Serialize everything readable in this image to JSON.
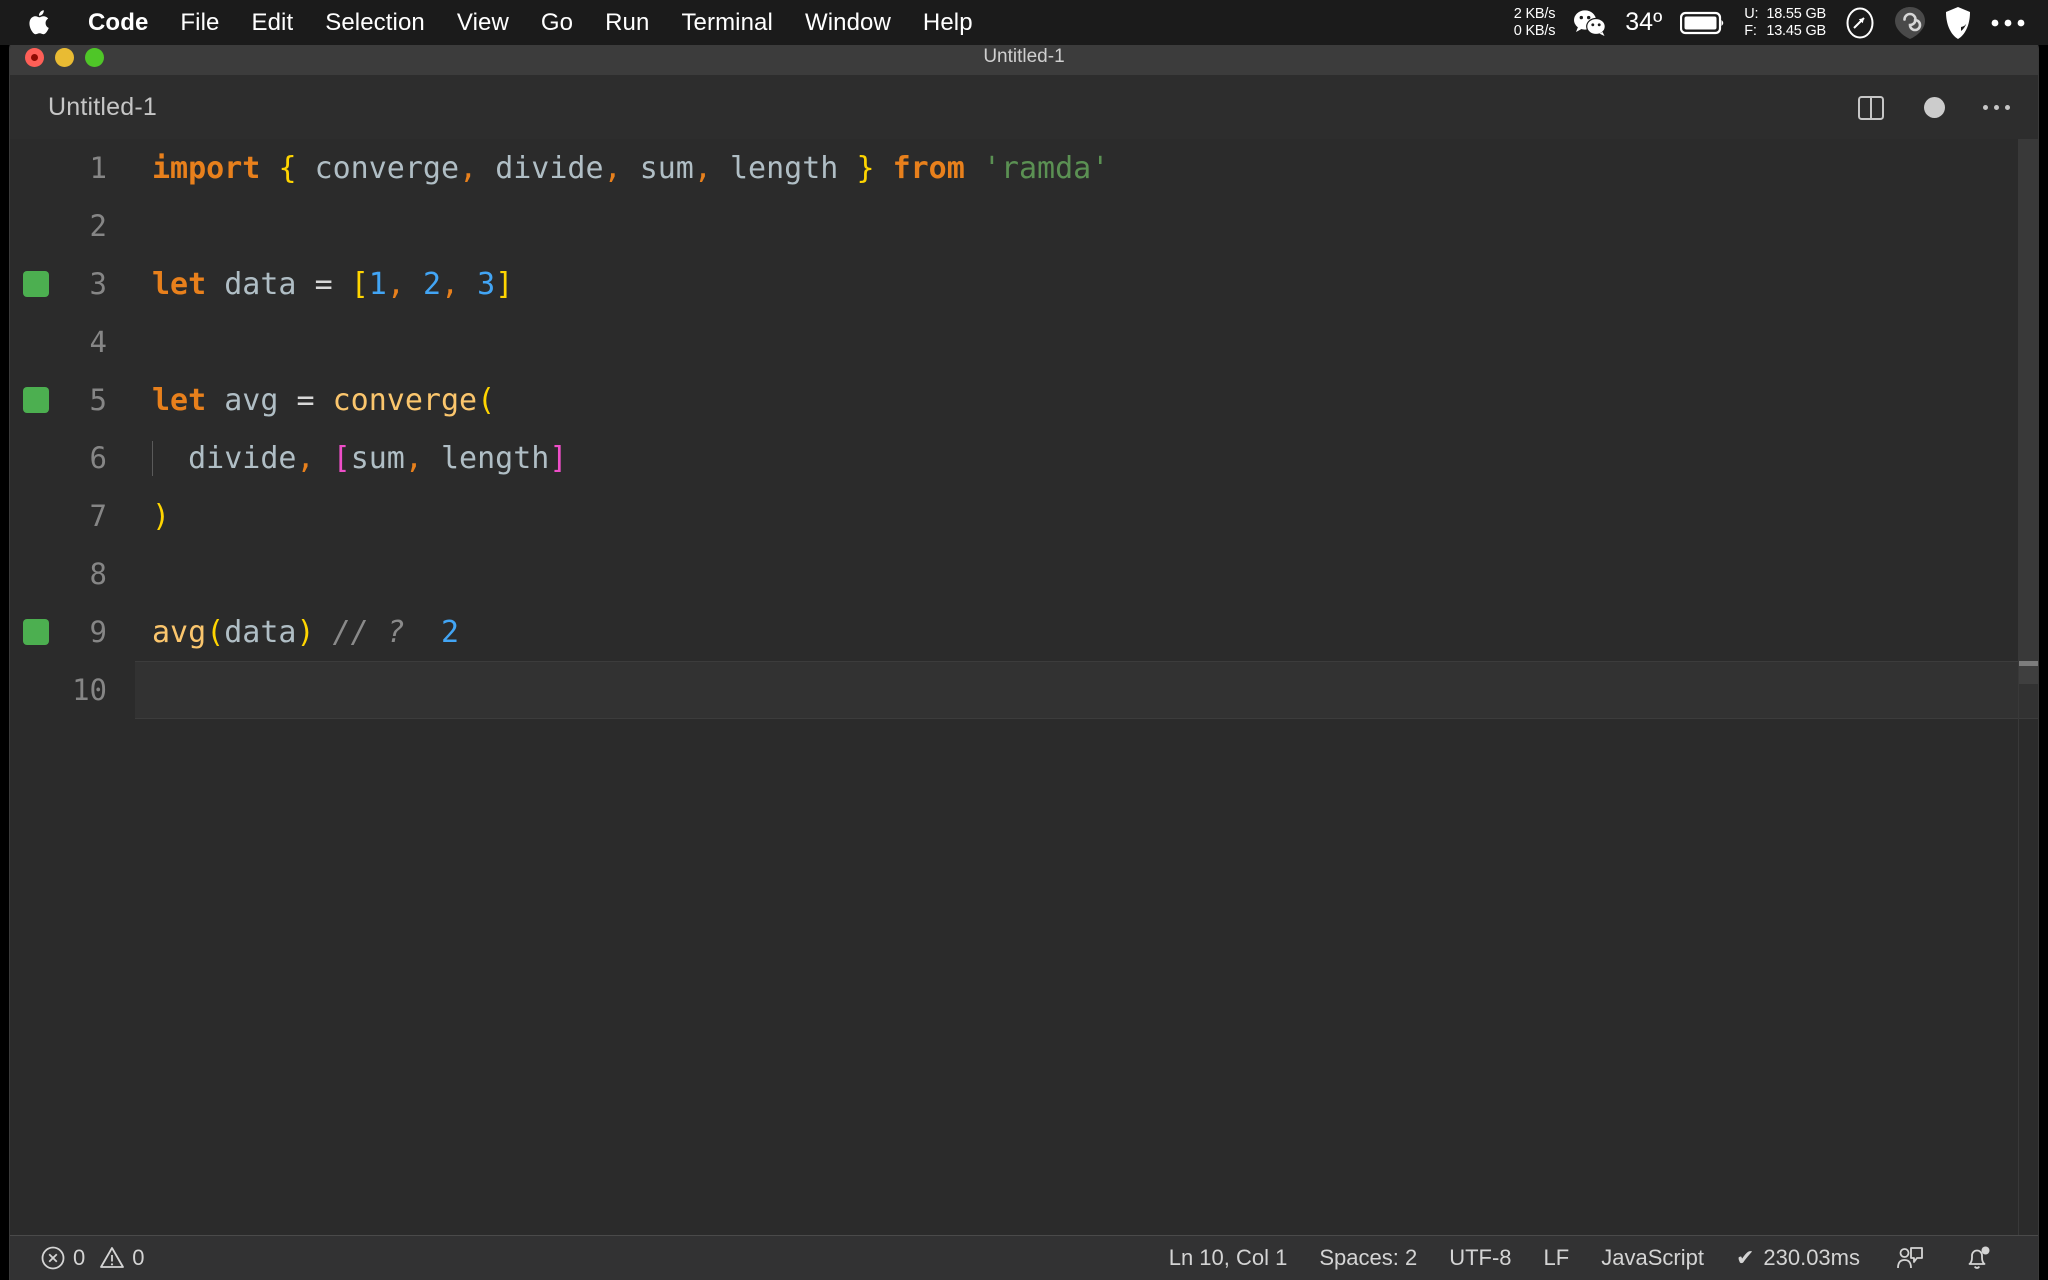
{
  "menubar": {
    "apple_icon": "apple-logo-icon",
    "items": [
      {
        "label": "Code",
        "bold": true
      },
      {
        "label": "File",
        "bold": false
      },
      {
        "label": "Edit",
        "bold": false
      },
      {
        "label": "Selection",
        "bold": false
      },
      {
        "label": "View",
        "bold": false
      },
      {
        "label": "Go",
        "bold": false
      },
      {
        "label": "Run",
        "bold": false
      },
      {
        "label": "Terminal",
        "bold": false
      },
      {
        "label": "Window",
        "bold": false
      },
      {
        "label": "Help",
        "bold": false
      }
    ],
    "status": {
      "net_up": "2 KB/s",
      "net_down": "0 KB/s",
      "wechat_icon": "wechat-icon",
      "temperature": "34º",
      "battery_icon": "battery-icon",
      "mem_used_label": "U:",
      "mem_used_value": "18.55 GB",
      "mem_free_label": "F:",
      "mem_free_value": "13.45 GB",
      "compass_icon": "compass-icon",
      "cloud_icon": "cloud-sync-icon",
      "shield_icon": "shield-icon",
      "more_icon": "control-center-more-icon"
    }
  },
  "window": {
    "title": "Untitled-1",
    "traffic": {
      "close": "close-window-button",
      "minimize": "minimize-window-button",
      "maximize": "maximize-window-button"
    }
  },
  "editor": {
    "tab_label": "Untitled-1",
    "split_icon": "split-editor-icon",
    "dirty_icon": "unsaved-changes-dot",
    "more_icon": "more-actions-icon",
    "lines": [
      {
        "num": "1",
        "marked": false,
        "indent_guide": false,
        "current": false,
        "tokens": [
          {
            "text": "import",
            "cls": "t-kw"
          },
          {
            "text": " ",
            "cls": "t-op"
          },
          {
            "text": "{",
            "cls": "t-br1"
          },
          {
            "text": " ",
            "cls": "t-op"
          },
          {
            "text": "converge",
            "cls": "t-ident"
          },
          {
            "text": ",",
            "cls": "t-punct"
          },
          {
            "text": " ",
            "cls": "t-op"
          },
          {
            "text": "divide",
            "cls": "t-ident"
          },
          {
            "text": ",",
            "cls": "t-punct"
          },
          {
            "text": " ",
            "cls": "t-op"
          },
          {
            "text": "sum",
            "cls": "t-ident"
          },
          {
            "text": ",",
            "cls": "t-punct"
          },
          {
            "text": " ",
            "cls": "t-op"
          },
          {
            "text": "length",
            "cls": "t-ident"
          },
          {
            "text": " ",
            "cls": "t-op"
          },
          {
            "text": "}",
            "cls": "t-br1"
          },
          {
            "text": " ",
            "cls": "t-op"
          },
          {
            "text": "from",
            "cls": "t-kw"
          },
          {
            "text": " ",
            "cls": "t-op"
          },
          {
            "text": "'ramda'",
            "cls": "t-str"
          }
        ]
      },
      {
        "num": "2",
        "marked": false,
        "indent_guide": false,
        "current": false,
        "tokens": []
      },
      {
        "num": "3",
        "marked": true,
        "indent_guide": false,
        "current": false,
        "tokens": [
          {
            "text": "let",
            "cls": "t-kw"
          },
          {
            "text": " ",
            "cls": "t-op"
          },
          {
            "text": "data",
            "cls": "t-ident"
          },
          {
            "text": " ",
            "cls": "t-op"
          },
          {
            "text": "=",
            "cls": "t-op"
          },
          {
            "text": " ",
            "cls": "t-op"
          },
          {
            "text": "[",
            "cls": "t-br1"
          },
          {
            "text": "1",
            "cls": "t-num"
          },
          {
            "text": ",",
            "cls": "t-punct"
          },
          {
            "text": " ",
            "cls": "t-op"
          },
          {
            "text": "2",
            "cls": "t-num"
          },
          {
            "text": ",",
            "cls": "t-punct"
          },
          {
            "text": " ",
            "cls": "t-op"
          },
          {
            "text": "3",
            "cls": "t-num"
          },
          {
            "text": "]",
            "cls": "t-br1"
          }
        ]
      },
      {
        "num": "4",
        "marked": false,
        "indent_guide": false,
        "current": false,
        "tokens": []
      },
      {
        "num": "5",
        "marked": true,
        "indent_guide": false,
        "current": false,
        "tokens": [
          {
            "text": "let",
            "cls": "t-kw"
          },
          {
            "text": " ",
            "cls": "t-op"
          },
          {
            "text": "avg",
            "cls": "t-ident"
          },
          {
            "text": " ",
            "cls": "t-op"
          },
          {
            "text": "=",
            "cls": "t-op"
          },
          {
            "text": " ",
            "cls": "t-op"
          },
          {
            "text": "converge",
            "cls": "t-func"
          },
          {
            "text": "(",
            "cls": "t-br1"
          }
        ]
      },
      {
        "num": "6",
        "marked": false,
        "indent_guide": true,
        "current": false,
        "tokens": [
          {
            "text": "  ",
            "cls": "t-op"
          },
          {
            "text": "divide",
            "cls": "t-ident"
          },
          {
            "text": ",",
            "cls": "t-punct"
          },
          {
            "text": " ",
            "cls": "t-op"
          },
          {
            "text": "[",
            "cls": "t-br2"
          },
          {
            "text": "sum",
            "cls": "t-ident"
          },
          {
            "text": ",",
            "cls": "t-punct"
          },
          {
            "text": " ",
            "cls": "t-op"
          },
          {
            "text": "length",
            "cls": "t-ident"
          },
          {
            "text": "]",
            "cls": "t-br2"
          }
        ]
      },
      {
        "num": "7",
        "marked": false,
        "indent_guide": false,
        "current": false,
        "tokens": [
          {
            "text": ")",
            "cls": "t-br1"
          }
        ]
      },
      {
        "num": "8",
        "marked": false,
        "indent_guide": false,
        "current": false,
        "tokens": []
      },
      {
        "num": "9",
        "marked": true,
        "indent_guide": false,
        "current": false,
        "tokens": [
          {
            "text": "avg",
            "cls": "t-func"
          },
          {
            "text": "(",
            "cls": "t-br1"
          },
          {
            "text": "data",
            "cls": "t-ident"
          },
          {
            "text": ")",
            "cls": "t-br1"
          },
          {
            "text": " ",
            "cls": "t-op"
          },
          {
            "text": "// ?",
            "cls": "t-comment"
          },
          {
            "text": "  ",
            "cls": "t-op"
          },
          {
            "text": "2",
            "cls": "t-num"
          }
        ]
      },
      {
        "num": "10",
        "marked": false,
        "indent_guide": false,
        "current": true,
        "tokens": []
      }
    ]
  },
  "statusbar": {
    "errors_icon": "error-circle-icon",
    "errors_count": "0",
    "warnings_icon": "warning-triangle-icon",
    "warnings_count": "0",
    "cursor_position": "Ln 10, Col 1",
    "indentation": "Spaces: 2",
    "encoding": "UTF-8",
    "eol": "LF",
    "language": "JavaScript",
    "quokka_check": "✔",
    "quokka_time": "230.03ms",
    "feedback_icon": "feedback-person-icon",
    "bell_icon": "notification-bell-icon"
  },
  "colors": {
    "accent_keyword": "#e8801c",
    "accent_function": "#fbc66d",
    "accent_bracket1": "#ffd500",
    "accent_bracket2": "#ee4ec8",
    "accent_number": "#42a5f5",
    "accent_string": "#5b9153",
    "gutter_marker": "#4caf50",
    "editor_bg": "#2b2b2b",
    "statusbar_bg": "#323233"
  }
}
